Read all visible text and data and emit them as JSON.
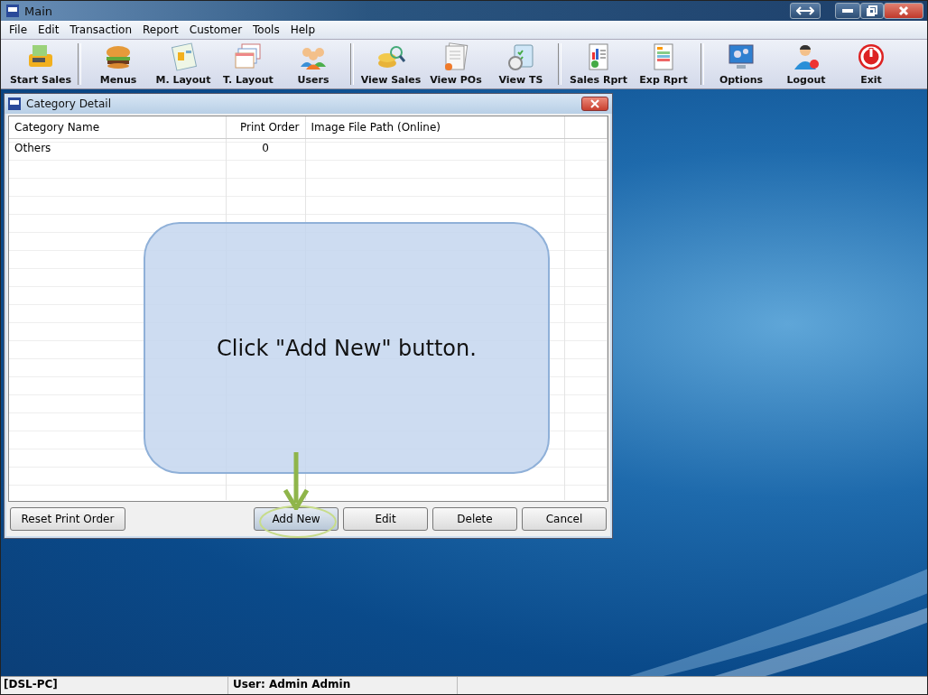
{
  "window": {
    "title": "Main"
  },
  "menu": [
    "File",
    "Edit",
    "Transaction",
    "Report",
    "Customer",
    "Tools",
    "Help"
  ],
  "toolbar": {
    "groups": [
      {
        "items": [
          {
            "label": "Start Sales"
          }
        ]
      },
      {
        "items": [
          {
            "label": "Menus"
          },
          {
            "label": "M. Layout"
          },
          {
            "label": "T. Layout"
          },
          {
            "label": "Users"
          }
        ]
      },
      {
        "items": [
          {
            "label": "View Sales"
          },
          {
            "label": "View POs"
          },
          {
            "label": "View TS"
          }
        ]
      },
      {
        "items": [
          {
            "label": "Sales Rprt"
          },
          {
            "label": "Exp Rprt"
          }
        ]
      },
      {
        "items": [
          {
            "label": "Options"
          },
          {
            "label": "Logout"
          },
          {
            "label": "Exit"
          }
        ]
      }
    ]
  },
  "dialog": {
    "title": "Category Detail",
    "table": {
      "columns": [
        "Category Name",
        "Print Order",
        "Image File Path (Online)"
      ],
      "rows": [
        {
          "name": "Others",
          "print_order": "0"
        }
      ]
    },
    "buttons": [
      {
        "label": "Reset Print Order",
        "highlighted": false
      },
      {
        "label": "Add New",
        "highlighted": true
      },
      {
        "label": "Edit",
        "highlighted": false
      },
      {
        "label": "Delete",
        "highlighted": false
      },
      {
        "label": "Cancel",
        "highlighted": false
      }
    ]
  },
  "callout": {
    "text": "Click \"Add New\" button."
  },
  "status_bar": [
    "[DSL-PC]",
    "User: Admin Admin"
  ]
}
